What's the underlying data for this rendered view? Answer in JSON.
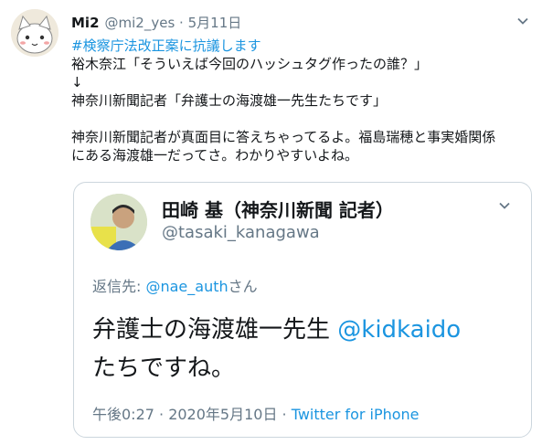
{
  "tweet": {
    "author_name": "Mi2",
    "author_handle": "@mi2_yes",
    "separator": "·",
    "date": "5月11日",
    "lines": [
      "#検察庁法改正案に抗議します",
      "裕木奈江「そういえば今回のハッシュタグ作ったの誰？」",
      "↓",
      "神奈川新聞記者「弁護士の海渡雄一先生たちです」"
    ],
    "lines2": [
      "神奈川新聞記者が真面目に答えちゃってるよ。福島瑞穂と事実婚関係",
      "にある海渡雄一だってさ。わかりやすいよね。"
    ],
    "menu_icon": "chevron-down-icon"
  },
  "quoted": {
    "author_name": "田崎 基（神奈川新聞 記者）",
    "author_handle": "@tasaki_kanagawa",
    "reply_prefix": "返信先: ",
    "reply_mention": "@nae_auth",
    "reply_suffix": "さん",
    "text_line1": "弁護士の海渡雄一先生 ",
    "text_mention": "@kidkaido",
    "text_line2": "たちですね。",
    "time": "午後0:27 · 2020年5月10日 · ",
    "client": "Twitter for iPhone"
  },
  "colors": {
    "link": "#1b95e0",
    "muted": "#657786",
    "border": "#ccd6dd"
  }
}
